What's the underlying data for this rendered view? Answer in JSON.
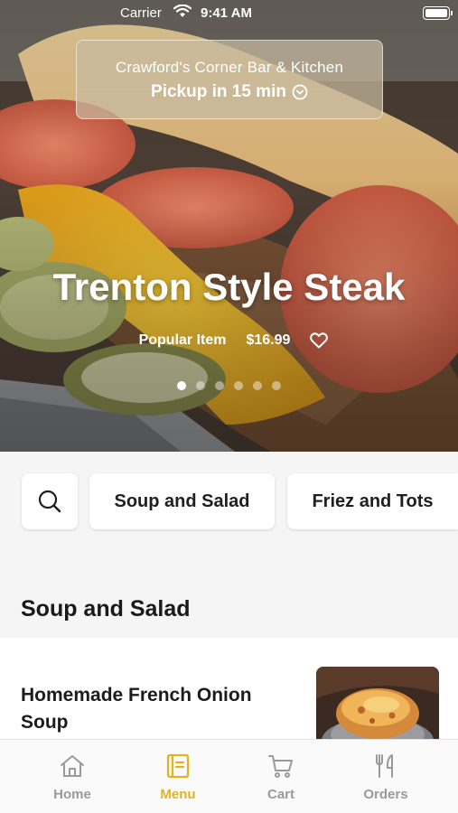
{
  "status_bar": {
    "carrier": "Carrier",
    "time": "9:41 AM"
  },
  "pickup": {
    "restaurant_name": "Crawford's Corner Bar & Kitchen",
    "pickup_text": "Pickup in 15 min"
  },
  "hero": {
    "title": "Trenton Style Steak",
    "badge": "Popular Item",
    "price": "$16.99",
    "carousel": {
      "pages": 6,
      "active_index": 0
    }
  },
  "categories": {
    "search_icon": "search-icon",
    "items": [
      "Soup and Salad",
      "Friez and Tots"
    ]
  },
  "section": {
    "title": "Soup and Salad"
  },
  "menu_items": [
    {
      "name": "Homemade French Onion Soup"
    }
  ],
  "tab_bar": {
    "tabs": [
      {
        "label": "Home",
        "icon": "home-icon",
        "active": false
      },
      {
        "label": "Menu",
        "icon": "menu-book-icon",
        "active": true
      },
      {
        "label": "Cart",
        "icon": "cart-icon",
        "active": false
      },
      {
        "label": "Orders",
        "icon": "fork-knife-icon",
        "active": false
      }
    ]
  },
  "colors": {
    "accent": "#e2b31d",
    "inactive": "#9a9a9a"
  }
}
